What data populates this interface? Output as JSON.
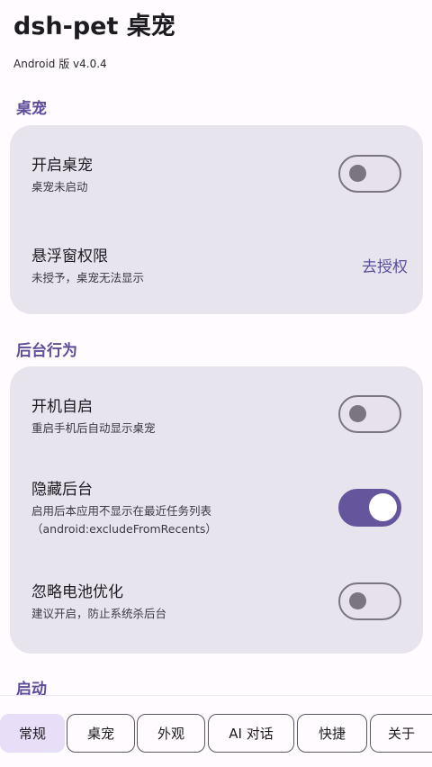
{
  "header": {
    "title": "dsh-pet 桌宠",
    "subtitle": "Android 版 v4.0.4"
  },
  "sections": {
    "pet": {
      "title": "桌宠",
      "enable": {
        "title": "开启桌宠",
        "desc": "桌宠未启动",
        "on": false
      },
      "overlay": {
        "title": "悬浮窗权限",
        "desc": "未授予，桌宠无法显示",
        "action": "去授权"
      }
    },
    "background": {
      "title": "后台行为",
      "autostart": {
        "title": "开机自启",
        "desc": "重启手机后自动显示桌宠",
        "on": false
      },
      "hide": {
        "title": "隐藏后台",
        "desc": "启用后本应用不显示在最近任务列表",
        "desc2": "（android:excludeFromRecents）",
        "on": true
      },
      "battery": {
        "title": "忽略电池优化",
        "desc": "建议开启，防止系统杀后台",
        "on": false
      }
    },
    "launch": {
      "title": "启动"
    }
  },
  "tabs": [
    {
      "label": "常规",
      "selected": true
    },
    {
      "label": "桌宠",
      "selected": false
    },
    {
      "label": "外观",
      "selected": false
    },
    {
      "label": "AI 对话",
      "selected": false
    },
    {
      "label": "快捷",
      "selected": false
    },
    {
      "label": "关于",
      "selected": false
    }
  ],
  "colors": {
    "accent": "#65559d",
    "section_title": "#5f4c9a",
    "card_bg": "#e8e4ee",
    "selected_tab_bg": "#e8def8"
  }
}
